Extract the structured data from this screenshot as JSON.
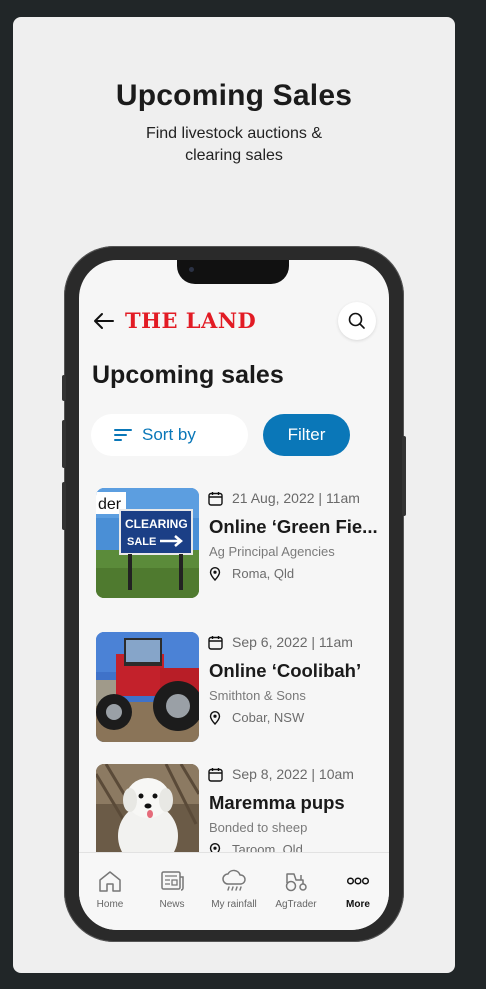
{
  "hero": {
    "title": "Upcoming Sales",
    "subtitle_line1": "Find livestock auctions &",
    "subtitle_line2": "clearing sales"
  },
  "app": {
    "logo_text": "THE LAND",
    "page_title": "Upcoming sales",
    "sort_label": "Sort by",
    "filter_label": "Filter",
    "colors": {
      "brand_red": "#e21b24",
      "accent_blue": "#0a77b8"
    }
  },
  "sales": [
    {
      "date": "21 Aug, 2022 | 11am",
      "title": "Online ‘Green Fie...",
      "agent": "Ag Principal Agencies",
      "location": "Roma, Qld",
      "image": "clearing-sale-sign",
      "sign_lines": [
        "CLEARING",
        "SALE"
      ],
      "sign_prefix": "der"
    },
    {
      "date": "Sep 6, 2022 | 11am",
      "title": "Online ‘Coolibah’",
      "agent": "Smithton & Sons",
      "location": "Cobar, NSW",
      "image": "red-tractor"
    },
    {
      "date": "Sep 8, 2022 | 10am",
      "title": "Maremma pups",
      "agent": "Bonded to sheep",
      "location": "Taroom, Qld",
      "image": "white-puppy"
    }
  ],
  "nav": {
    "items": [
      {
        "label": "Home",
        "icon": "home-icon"
      },
      {
        "label": "News",
        "icon": "news-icon"
      },
      {
        "label": "My rainfall",
        "icon": "rain-cloud-icon"
      },
      {
        "label": "AgTrader",
        "icon": "tractor-icon"
      },
      {
        "label": "More",
        "icon": "more-icon",
        "active": true
      }
    ]
  }
}
